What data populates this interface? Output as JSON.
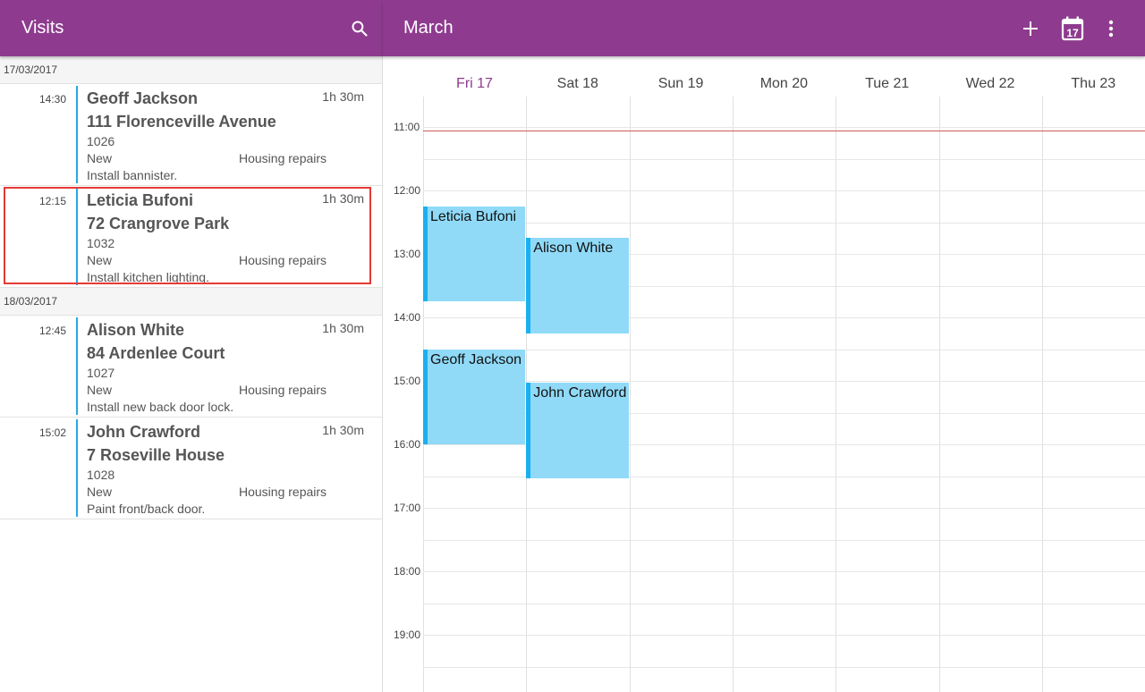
{
  "left_bar": {
    "title": "Visits",
    "search_icon": "search-icon"
  },
  "right_bar": {
    "title": "March",
    "add_icon": "plus-icon",
    "calendar_icon": "calendar-icon",
    "calendar_day": "17",
    "more_icon": "more-vert-icon"
  },
  "colors": {
    "app_bar": "#8e3b8f",
    "event_fill": "#90daf8",
    "event_border": "#1ab0ef",
    "selection": "#e53935",
    "now_line": "#d05a5a"
  },
  "groups": [
    {
      "date": "17/03/2017",
      "visits": [
        {
          "time": "14:30",
          "name": "Geoff Jackson",
          "duration": "1h 30m",
          "address": "111 Florenceville Avenue",
          "code": "1026",
          "status": "New",
          "category": "Housing repairs",
          "description": "Install bannister.",
          "selected": false
        },
        {
          "time": "12:15",
          "name": "Leticia Bufoni",
          "duration": "1h 30m",
          "address": "72 Crangrove Park",
          "code": "1032",
          "status": "New",
          "category": "Housing repairs",
          "description": "Install kitchen lighting.",
          "selected": true
        }
      ]
    },
    {
      "date": "18/03/2017",
      "visits": [
        {
          "time": "12:45",
          "name": "Alison White",
          "duration": "1h 30m",
          "address": "84 Ardenlee Court",
          "code": "1027",
          "status": "New",
          "category": "Housing repairs",
          "description": "Install new back door lock.",
          "selected": false
        },
        {
          "time": "15:02",
          "name": "John Crawford",
          "duration": "1h 30m",
          "address": "7 Roseville House",
          "code": "1028",
          "status": "New",
          "category": "Housing repairs",
          "description": "Paint front/back door.",
          "selected": false
        }
      ]
    }
  ],
  "calendar": {
    "days": [
      "Fri 17",
      "Sat 18",
      "Sun 19",
      "Mon 20",
      "Tue 21",
      "Wed 22",
      "Thu 23"
    ],
    "today_index": 0,
    "hours": [
      "11:00",
      "12:00",
      "13:00",
      "14:00",
      "15:00",
      "16:00",
      "17:00",
      "18:00",
      "19:00"
    ],
    "first_hour": 11,
    "current_time": 11.05,
    "events": [
      {
        "title": "Leticia Bufoni",
        "day": 0,
        "start": 12.25,
        "end": 13.75
      },
      {
        "title": "Alison White",
        "day": 1,
        "start": 12.75,
        "end": 14.25
      },
      {
        "title": "Geoff Jackson",
        "day": 0,
        "start": 14.5,
        "end": 16.0
      },
      {
        "title": "John Crawford",
        "day": 1,
        "start": 15.03,
        "end": 16.53
      }
    ]
  }
}
